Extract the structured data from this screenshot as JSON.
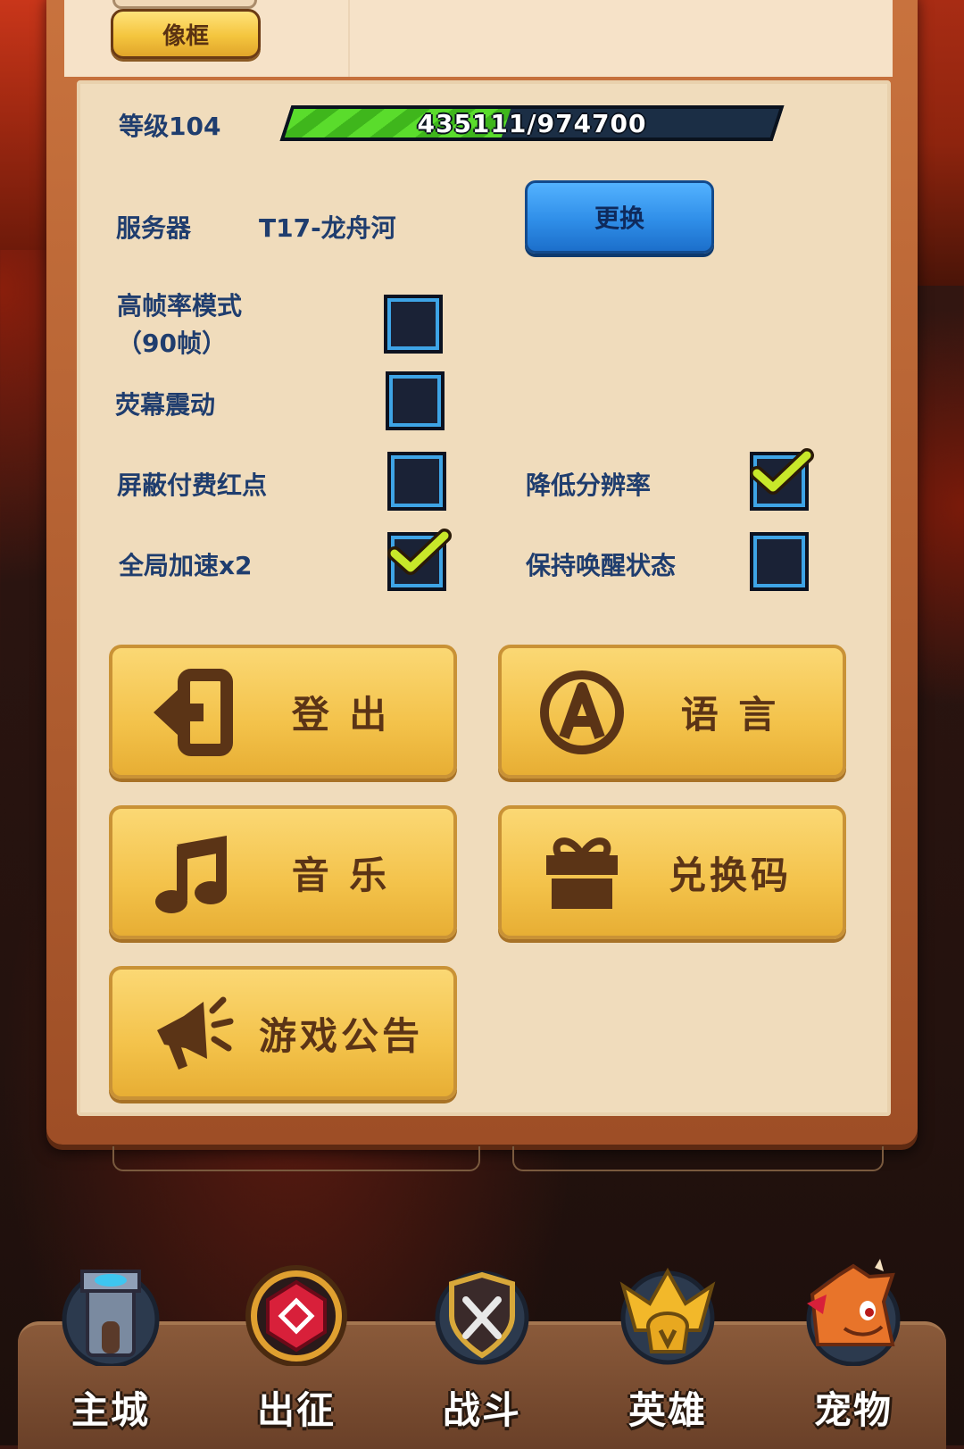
{
  "header": {
    "frame_tab_label": "像框"
  },
  "level": {
    "label": "等级104",
    "xp_text": "435111/974700",
    "xp_progress": 0.4464
  },
  "server": {
    "label": "服务器",
    "value": "T17-龙舟河",
    "change_button": "更换"
  },
  "settings": {
    "high_fps": {
      "label": "高帧率模式（90帧）",
      "checked": false
    },
    "screen_shake": {
      "label": "荧幕震动",
      "checked": false
    },
    "hide_pay_dot": {
      "label": "屏蔽付费红点",
      "checked": false
    },
    "lower_resolution": {
      "label": "降低分辨率",
      "checked": true
    },
    "global_speed": {
      "label": "全局加速x2",
      "checked": true
    },
    "keep_awake": {
      "label": "保持唤醒状态",
      "checked": false
    }
  },
  "buttons": {
    "logout": "登 出",
    "language": "语 言",
    "music": "音 乐",
    "redeem": "兑换码",
    "announcement": "游戏公告"
  },
  "nav": {
    "main_city": "主城",
    "expedition": "出征",
    "battle": "战斗",
    "heroes": "英雄",
    "pets": "宠物"
  },
  "colors": {
    "label_blue": "#1f3d6e",
    "button_gold": "#f3c24a",
    "button_blue": "#2f8ee8",
    "panel_bg": "#f0dcbc",
    "xp_green": "#5adc2c"
  }
}
